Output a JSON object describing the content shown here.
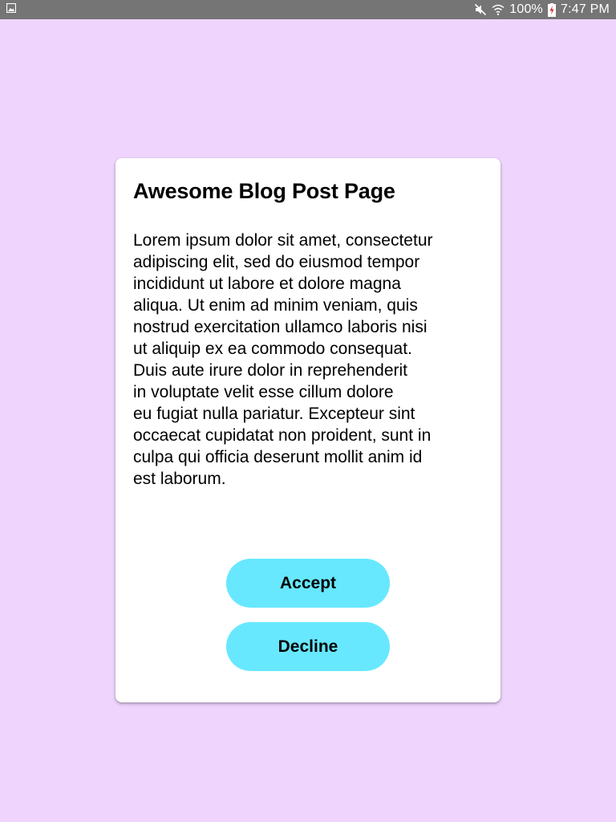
{
  "status_bar": {
    "left_icon": "image-notification-icon",
    "icons": [
      "mute-icon",
      "wifi-icon"
    ],
    "battery_text": "100%",
    "battery_icon": "battery-charging-icon",
    "time": "7:47 PM",
    "background_color": "#757575"
  },
  "dialog": {
    "title": "Awesome Blog Post Page",
    "body": "Lorem ipsum dolor sit amet, consectetur\nadipiscing elit, sed do eiusmod tempor\nincididunt ut labore et dolore magna\naliqua. Ut enim ad minim veniam, quis\nnostrud exercitation ullamco laboris nisi\nut aliquip ex ea commodo consequat.\nDuis aute irure dolor in reprehenderit\nin voluptate velit esse cillum dolore\neu fugiat nulla pariatur. Excepteur sint\noccaecat cupidatat non proident, sunt in\nculpa qui officia deserunt mollit anim id\nest laborum.",
    "accept_label": "Accept",
    "decline_label": "Decline",
    "button_color": "#67e8ff"
  },
  "page": {
    "background_color": "#efd5fd"
  }
}
